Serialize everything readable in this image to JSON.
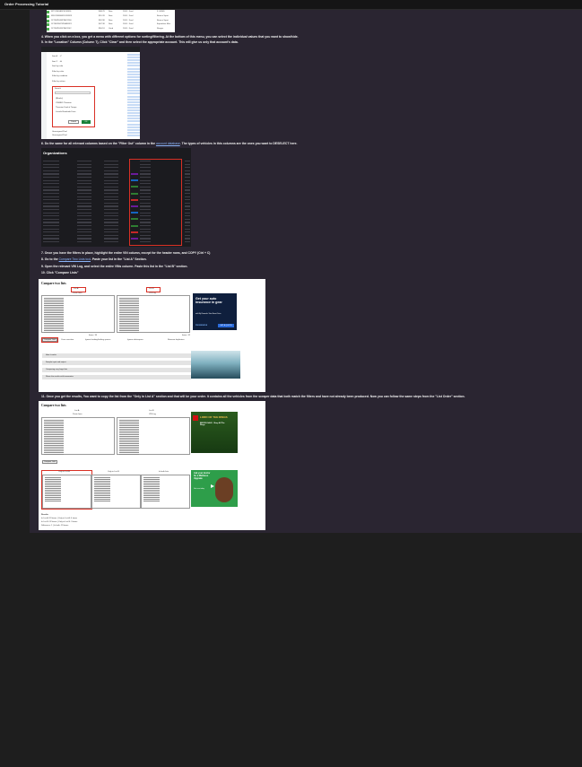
{
  "window": {
    "title": "Order Processing Tutorial"
  },
  "steps": {
    "s4": "4.  When you click on a box, you get a menu with different options for sorting/filtering. At the bottom of this menu, you can select the individual values that you want to show/hide.",
    "s5": "5.  In the \"Location\" Column (Column T), Click \"Clear\" and then select the appropriate account. This will give us only that account's data.",
    "s6_pre": "6.  Do the same for all relevant columns based on the \"Filter Out\" column in the ",
    "s6_link": "account database",
    "s6_post": ". The types of vehicles in this columns are the ones you want to DESELECT here.",
    "s7": "7.  Once you have the filters in place, highlight the entire VIN column, except for the header rows, and COPY (Ctrl + C)",
    "s8_pre": "8.  Go to the ",
    "s8_link": "Compare Two Lists tool",
    "s8_post": ". Paste your list in the \"List A\" Section.",
    "s9": "9.  Open the relevant VIN Log, and select the entire VINs column. Paste this list in the \"List B\" section.",
    "s10": "10.  Click \"Compare Lists\"",
    "s11": "11.  Once you get the results, You want to copy the list from the \"Only in List A\" section and that will be your order. It contains all the vehicles from the scraper data that both match the filters and have not already been produced. Now you can follow the same steps from the \"List Order\" section."
  },
  "shot1": {
    "rows": [
      {
        "vin": "WT1234SB5P0138916",
        "price": "$48.7K",
        "status": "New",
        "loc": "2024 · Ford",
        "city": "F. 3456D"
      },
      {
        "vin": "WFO2B3SB5P0138923",
        "price": "$51.2K",
        "status": "New",
        "loc": "2024 · Ford",
        "city": "Bronco Sport"
      },
      {
        "vin": "1FTFW1E58PFA71260",
        "price": "$52.9K",
        "status": "New",
        "loc": "2024 · Ford",
        "city": "Bronco Sport"
      },
      {
        "vin": "1FTEW1EP3PFA56921",
        "price": "$47.3K",
        "status": "New",
        "loc": "2024 · Ford",
        "city": "Expedition Max"
      },
      {
        "vin": "1FTFW1E55PFA71142",
        "price": "$50.1K",
        "status": "Used",
        "loc": "2024 · Ford",
        "city": "Ranger"
      }
    ]
  },
  "shot2": {
    "items": [
      "Sort A → Z",
      "Sort Z → A",
      "Sort by color",
      "Filter by color",
      "Filter by condition",
      "Filter by values"
    ],
    "dropdown_label": "Search",
    "options": [
      "(Blanks)",
      "OWNED Thornton",
      "Thornton Ford of Tempe",
      "Lincoln Roadside Drive"
    ],
    "cancel": "Cancel",
    "ok": "OK",
    "footer": [
      "Unassigned Pool",
      "Unassigned Pool"
    ]
  },
  "shot3": {
    "title": "Organizations"
  },
  "compare1": {
    "title": "Compare two lists",
    "list_a": "List A",
    "list_b": "List B",
    "sub_a": "Paste here",
    "sub_b": "VIN Log",
    "items_a": "Items: 33",
    "items_b": "Items: 32",
    "compare_btn": "Compare Lists",
    "opt1": "Case sensitive",
    "opt2": "Ignore leading/trailing spaces",
    "opt3": "Ignore whitespace",
    "remove": "Remove duplicates",
    "sections": [
      "How it works",
      "Sample input and output",
      "Comparing very large lists",
      "Share the results with teammates"
    ],
    "ad_title": "Get your auto insurance in gear",
    "ad_sub": "with My Rewards. Start Smart Drive",
    "ad_btn": "GET A QUOTE",
    "ad_brand": "PROGRESSIVE"
  },
  "compare2": {
    "title": "Compare two lists",
    "list_a": "List A",
    "list_b": "List B",
    "sub_a": "Paste here",
    "sub_b": "VIN Log",
    "compare_btn": "Compare Lists",
    "only_a": "Only in List A",
    "only_b": "Only in List B",
    "in_both": "In both lists",
    "results_title": "Results",
    "results": [
      "In List A:   33 items   |   Only in List A:   4 items",
      "In List B:   32 items   |   Only in List B:   3 items",
      "Difference:  1         |   In both:          29 items"
    ],
    "ad1_title": "LORD OF THE RINGS",
    "ad1_sub": "BRICKS SALE · Shop All The Rings",
    "ad2_title": "Ask your doctor for a Wellness Upgrade",
    "ad2_sub": "Get care today"
  },
  "colors": {
    "doc_bg": "#2a2531",
    "page_bg": "#1e1e1e",
    "link": "#8ab4f8",
    "highlight": "#d93025",
    "accent_green": "#4caf50"
  }
}
